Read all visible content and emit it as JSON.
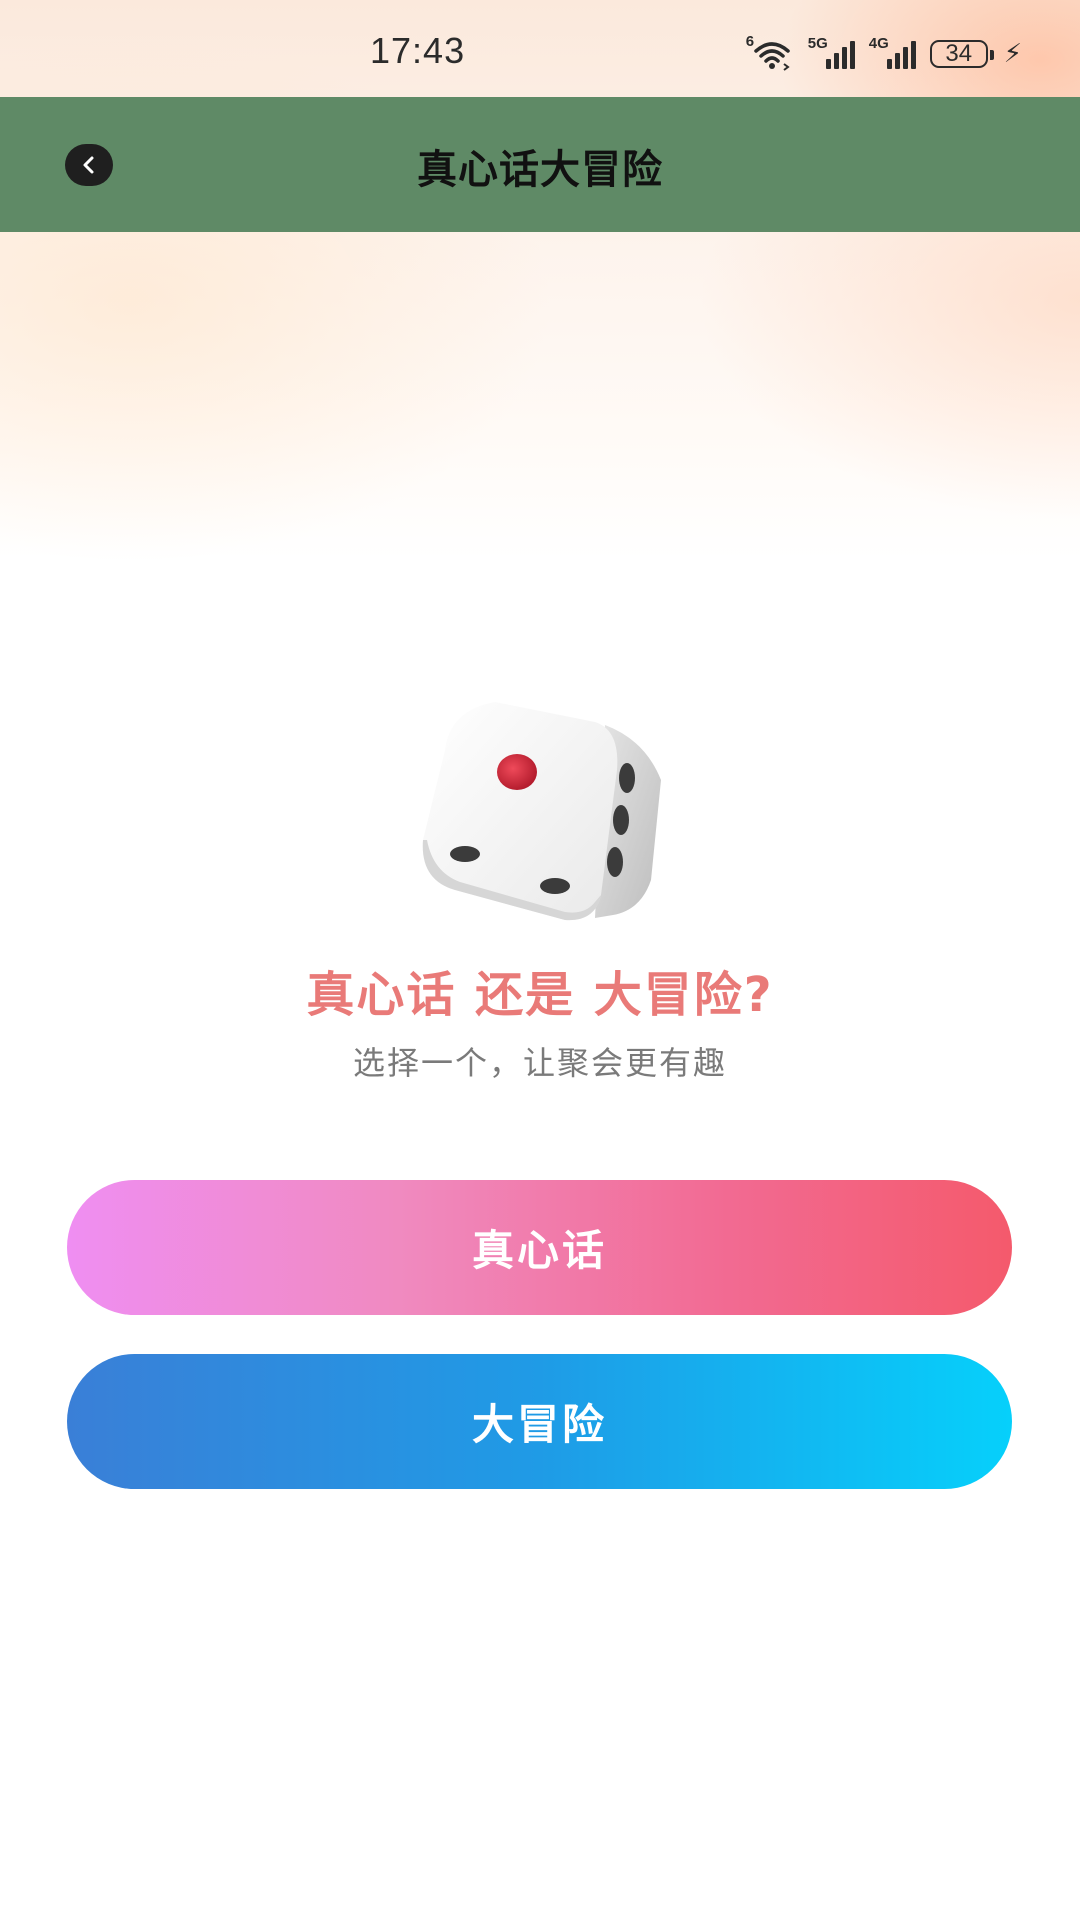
{
  "status_bar": {
    "time": "17:43",
    "wifi_gen": "6",
    "signal1_gen": "5G",
    "signal2_gen": "4G",
    "battery": "34"
  },
  "header": {
    "title": "真心话大冒险"
  },
  "main": {
    "headline": "真心话 还是 大冒险?",
    "subtitle": "选择一个，让聚会更有趣"
  },
  "buttons": {
    "truth_label": "真心话",
    "dare_label": "大冒险"
  },
  "colors": {
    "nav_bar": "#5f8a66",
    "headline": "#e97a78",
    "truth_gradient": [
      "#ef8ef2",
      "#f45a6c"
    ],
    "dare_gradient": [
      "#3a7fd7",
      "#06d0fb"
    ]
  },
  "icons": {
    "back": "chevron-left-icon",
    "hero": "dice-icon"
  }
}
